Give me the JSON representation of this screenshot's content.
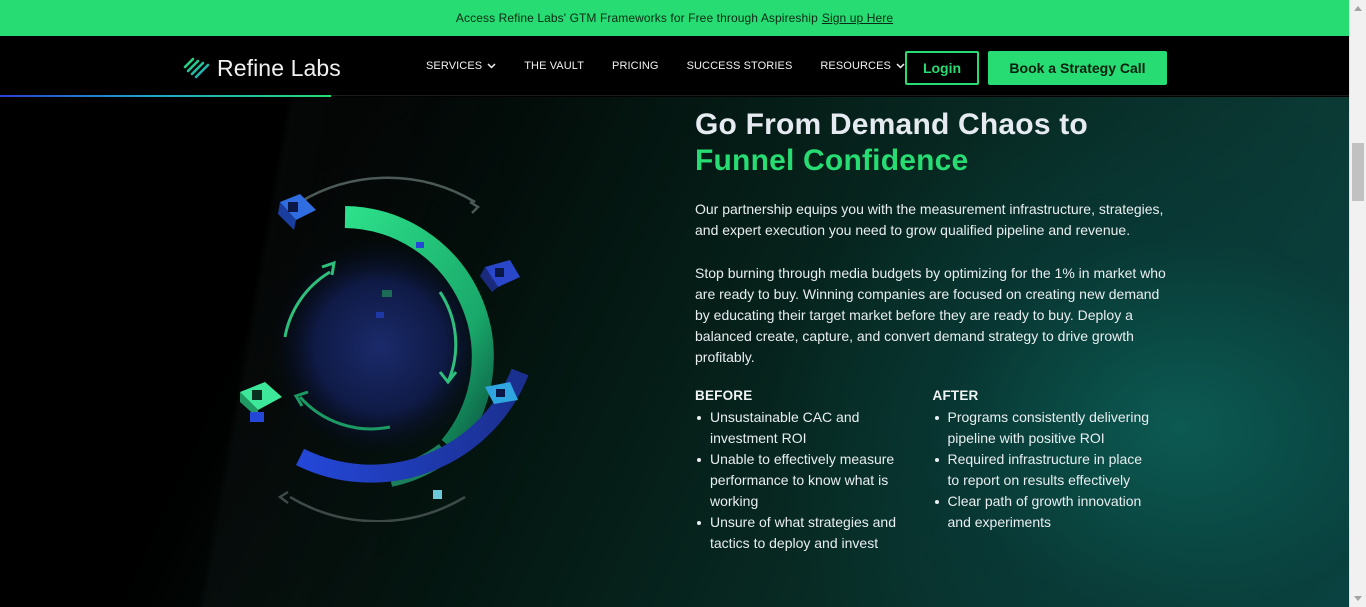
{
  "announcement": {
    "text": "Access Refine Labs' GTM Frameworks for Free through Aspireship",
    "link_label": "Sign up Here"
  },
  "header": {
    "logo_text": "Refine Labs",
    "nav": [
      {
        "label": "SERVICES",
        "has_dropdown": true
      },
      {
        "label": "THE VAULT",
        "has_dropdown": false
      },
      {
        "label": "PRICING",
        "has_dropdown": false
      },
      {
        "label": "SUCCESS STORIES",
        "has_dropdown": false
      },
      {
        "label": "RESOURCES",
        "has_dropdown": true
      }
    ],
    "login_label": "Login",
    "cta_label": "Book a Strategy Call"
  },
  "hero": {
    "heading_line1": "Go From Demand Chaos to",
    "heading_line2": "Funnel Confidence",
    "paragraph1": "Our partnership equips you with the measurement infrastructure, strategies, and expert execution you need to grow qualified pipeline and revenue.",
    "paragraph2": "Stop burning through media budgets by optimizing for the 1% in market who are ready to buy. Winning companies are focused on creating new demand by educating their target market before they are ready to buy. Deploy a balanced create, capture, and convert demand strategy to drive growth profitably.",
    "before": {
      "title": "BEFORE",
      "items": [
        "Unsustainable CAC and investment ROI",
        "Unable to effectively measure performance to know what is working",
        "Unsure of what strategies and tactics to deploy and invest"
      ]
    },
    "after": {
      "title": "AFTER",
      "items": [
        "Programs consistently delivering pipeline with positive ROI",
        "Required infrastructure in place to report on results effectively",
        "Clear path of growth innovation and experiments"
      ]
    }
  },
  "colors": {
    "accent_green": "#27dc72",
    "blue": "#2a3fd6",
    "heading_light": "#e6ebf2"
  }
}
